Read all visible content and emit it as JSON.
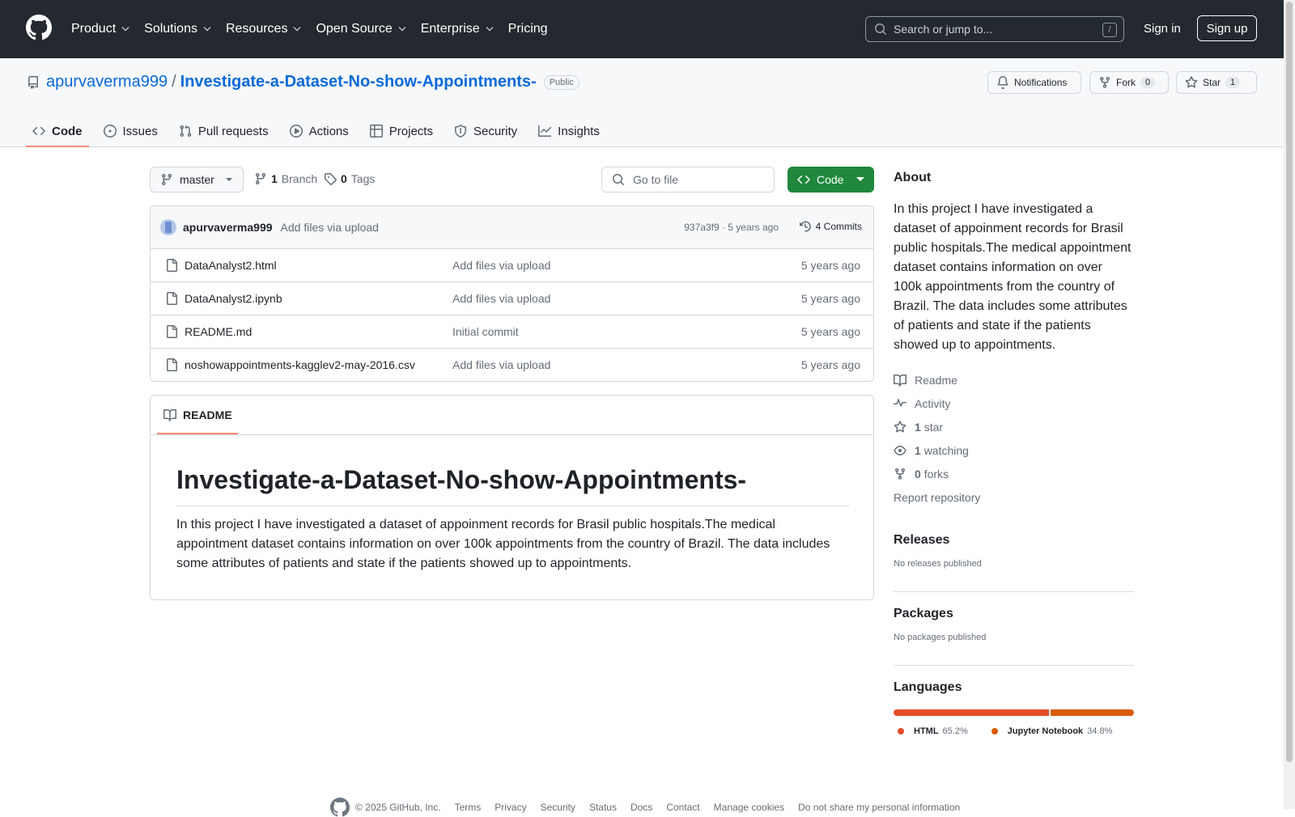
{
  "header": {
    "nav": [
      "Product",
      "Solutions",
      "Resources",
      "Open Source",
      "Enterprise",
      "Pricing"
    ],
    "search_placeholder": "Search or jump to...",
    "search_shortcut": "/",
    "sign_in": "Sign in",
    "sign_up": "Sign up"
  },
  "repo": {
    "owner": "apurvaverma999",
    "separator": "/",
    "name": "Investigate-a-Dataset-No-show-Appointments-",
    "visibility": "Public",
    "notifications": "Notifications",
    "fork_label": "Fork",
    "fork_count": "0",
    "star_label": "Star",
    "star_count": "1"
  },
  "tabs": [
    "Code",
    "Issues",
    "Pull requests",
    "Actions",
    "Projects",
    "Security",
    "Insights"
  ],
  "toolbar": {
    "branch": "master",
    "branch_count": "1",
    "branch_label": "Branch",
    "tag_count": "0",
    "tag_label": "Tags",
    "go_to_file": "Go to file",
    "code_button": "Code"
  },
  "latest_commit": {
    "author": "apurvaverma999",
    "message": "Add files via upload",
    "meta": "937a3f9 · 5 years ago",
    "commits": "4 Commits"
  },
  "files": [
    {
      "name": "DataAnalyst2.html",
      "message": "Add files via upload",
      "age": "5 years ago"
    },
    {
      "name": "DataAnalyst2.ipynb",
      "message": "Add files via upload",
      "age": "5 years ago"
    },
    {
      "name": "README.md",
      "message": "Initial commit",
      "age": "5 years ago"
    },
    {
      "name": "noshowappointments-kagglev2-may-2016.csv",
      "message": "Add files via upload",
      "age": "5 years ago"
    }
  ],
  "readme": {
    "tab": "README",
    "title": "Investigate-a-Dataset-No-show-Appointments-",
    "body": "In this project I have investigated a dataset of appoinment records for Brasil public hospitals.The medical appointment dataset contains information on over 100k appointments from the country of Brazil. The data includes some attributes of patients and state if the patients showed up to appointments."
  },
  "about": {
    "heading": "About",
    "description": "In this project I have investigated a dataset of appoinment records for Brasil public hospitals.The medical appointment dataset contains information on over 100k appointments from the country of Brazil. The data includes some attributes of patients and state if the patients showed up to appointments.",
    "readme": "Readme",
    "activity": "Activity",
    "stars_count": "1",
    "stars_label": "star",
    "watching_count": "1",
    "watching_label": "watching",
    "forks_count": "0",
    "forks_label": "forks",
    "report": "Report repository"
  },
  "releases": {
    "heading": "Releases",
    "text": "No releases published"
  },
  "packages": {
    "heading": "Packages",
    "text": "No packages published"
  },
  "languages": {
    "heading": "Languages",
    "items": [
      {
        "name": "HTML",
        "percent": "65.2%",
        "value": 65.2,
        "color": "#e34c26"
      },
      {
        "name": "Jupyter Notebook",
        "percent": "34.8%",
        "value": 34.8,
        "color": "#DA5B0B"
      }
    ]
  },
  "footer": [
    "© 2025 GitHub, Inc.",
    "Terms",
    "Privacy",
    "Security",
    "Status",
    "Docs",
    "Contact",
    "Manage cookies",
    "Do not share my personal information"
  ]
}
